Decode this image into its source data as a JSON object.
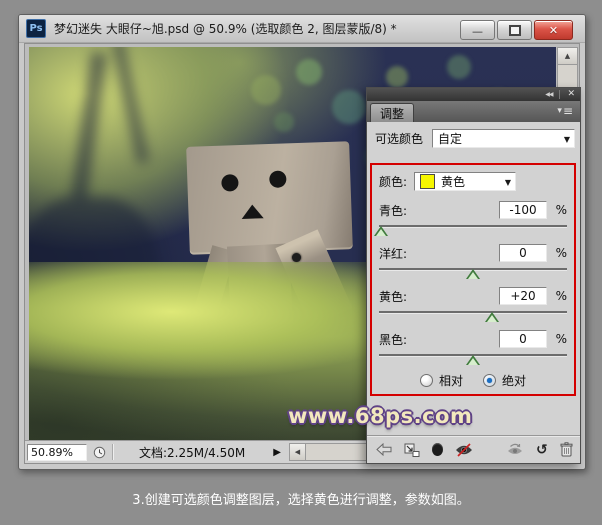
{
  "colors": {
    "highlight_box": "#d40000",
    "selected_radio": "#1a6fc4",
    "color_swatch": "#f6f600",
    "watermark_fill": "#f2e8bd",
    "watermark_outline": "#5f4286"
  },
  "window": {
    "app_badge": "Ps",
    "title": "梦幻迷失 大眼仔~旭.psd @ 50.9% (选取颜色 2, 图层蒙版/8) *",
    "controls": {
      "minimize_glyph": "—",
      "close_glyph": "✕"
    }
  },
  "panel": {
    "collapse_glyph": "◀◀",
    "close_glyph": "✕",
    "menu_arrow_glyph": "▾",
    "menu_lines_glyph": "≡",
    "tab_label": "调整",
    "preset_label": "可选颜色",
    "preset_value": "自定",
    "dropdown_arrow_glyph": "▼",
    "color_row": {
      "label": "颜色:",
      "value": "黄色"
    },
    "sliders": [
      {
        "label": "青色:",
        "value": "-100",
        "unit": "%",
        "position_pct": 1
      },
      {
        "label": "洋红:",
        "value": "0",
        "unit": "%",
        "position_pct": 50
      },
      {
        "label": "黄色:",
        "value": "+20",
        "unit": "%",
        "position_pct": 60
      },
      {
        "label": "黑色:",
        "value": "0",
        "unit": "%",
        "position_pct": 50
      }
    ],
    "radios": [
      {
        "label": "相对",
        "selected": false
      },
      {
        "label": "绝对",
        "selected": true
      }
    ],
    "footer_icons": [
      "back-arrow",
      "expand-panel",
      "clip-to-layer",
      "toggle-visibility",
      "previous-state",
      "reset",
      "delete"
    ]
  },
  "statusbar": {
    "zoom_value": "50.89%",
    "doc_info": "文档:2.25M/4.50M",
    "expand_glyph": "▶",
    "scroll_left_glyph": "◀",
    "scroll_up_glyph": "▲"
  },
  "watermark": "www.68ps.com",
  "caption": "3.创建可选颜色调整图层，选择黄色进行调整，参数如图。"
}
